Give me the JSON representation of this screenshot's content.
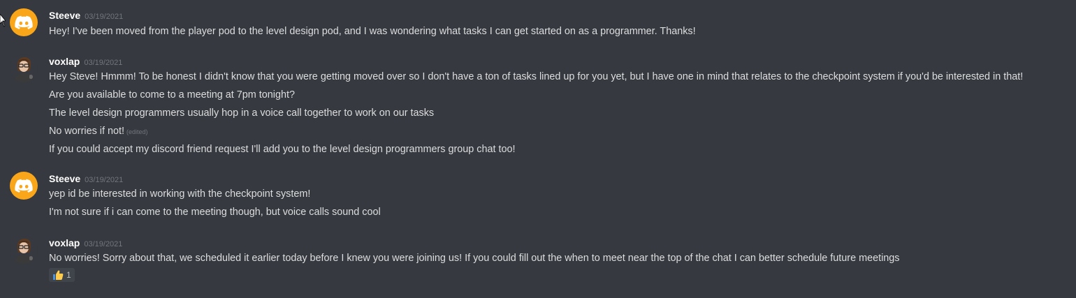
{
  "messages": [
    {
      "author": "Steeve",
      "timestamp": "03/19/2021",
      "avatar": "discord-logo-icon",
      "avatar_color": "#faa61a",
      "lines": [
        {
          "text": "Hey! I've been moved from the player pod to the level design pod, and I was wondering what tasks I can get started on as a programmer. Thanks!"
        }
      ]
    },
    {
      "author": "voxlap",
      "timestamp": "03/19/2021",
      "avatar": "user-photo-avatar",
      "lines": [
        {
          "text": "Hey Steve! Hmmm! To be honest I didn't know that you were getting moved over so I don't have a ton of tasks lined up for you yet, but I have one in mind that relates to the checkpoint system if you'd be interested in that!"
        },
        {
          "text": "Are you available to come to a meeting at 7pm tonight?"
        },
        {
          "text": "The level design programmers usually hop in a voice call together to work on our tasks"
        },
        {
          "text": "No worries if not!",
          "edited": "(edited)"
        },
        {
          "text": "If you could accept my discord friend request I'll add you to the level design programmers group chat too!"
        }
      ]
    },
    {
      "author": "Steeve",
      "timestamp": "03/19/2021",
      "avatar": "discord-logo-icon",
      "avatar_color": "#faa61a",
      "lines": [
        {
          "text": "yep id be interested in working with the checkpoint system!"
        },
        {
          "text": "I'm not sure if i can come to the meeting though, but voice calls sound cool"
        }
      ]
    },
    {
      "author": "voxlap",
      "timestamp": "03/19/2021",
      "avatar": "user-photo-avatar",
      "lines": [
        {
          "text": "No worries! Sorry about that, we scheduled it earlier today before I knew you were joining us! If you could fill out the when to meet near the top of the chat I can better schedule future meetings"
        }
      ],
      "reaction": {
        "emoji": "thumbs-up-icon",
        "count": "1"
      }
    }
  ]
}
